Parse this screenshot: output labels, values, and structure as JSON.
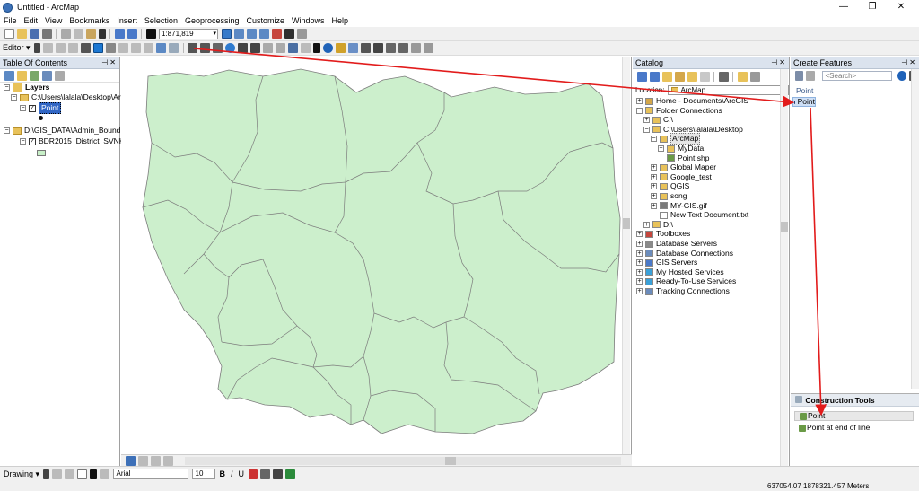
{
  "window": {
    "title": "Untitled - ArcMap",
    "controls": [
      "—",
      "❐",
      "✕"
    ]
  },
  "menu": [
    "File",
    "Edit",
    "View",
    "Bookmarks",
    "Insert",
    "Selection",
    "Geoprocessing",
    "Customize",
    "Windows",
    "Help"
  ],
  "toolbar": {
    "scale": "1:871,819",
    "editor_label": "Editor ▾"
  },
  "toc": {
    "title": "Table Of Contents",
    "layers_label": "Layers",
    "group1": "C:\\Users\\lalala\\Desktop\\Arc",
    "layer_point": "Point",
    "group2": "D:\\GIS_DATA\\Admin_Bound",
    "layer_district": "BDR2015_District_SVNK",
    "colors": {
      "district_swatch": "#c8f0c8",
      "selection": "#3166c4"
    }
  },
  "map": {
    "fill": "#ccefcc",
    "stroke": "#7c7c7c"
  },
  "catalog": {
    "title": "Catalog",
    "location_label": "Location:",
    "location_value": "ArcMap",
    "items": [
      "Home - Documents\\ArcGIS",
      "Folder Connections",
      "C:\\",
      "C:\\Users\\lalala\\Desktop",
      "ArcMap",
      "MyData",
      "Point.shp",
      "Global Maper",
      "Google_test",
      "QGIS",
      "song",
      "MY-GIS.gif",
      "New Text Document.txt",
      "D:\\",
      "Toolboxes",
      "Database Servers",
      "Database Connections",
      "GIS Servers",
      "My Hosted Services",
      "Ready-To-Use Services",
      "Tracking Connections"
    ]
  },
  "create_features": {
    "title": "Create Features",
    "search_placeholder": "<Search>",
    "group": "Point",
    "template": "Point"
  },
  "construction_tools": {
    "title": "Construction Tools",
    "items": [
      "Point",
      "Point at end of line"
    ]
  },
  "drawing": {
    "label": "Drawing ▾",
    "font": "Arial",
    "size": "10"
  },
  "status": {
    "coords": "637054.07  1878321.457 Meters"
  },
  "annotation": {
    "arrow_color": "#e21b1b"
  }
}
